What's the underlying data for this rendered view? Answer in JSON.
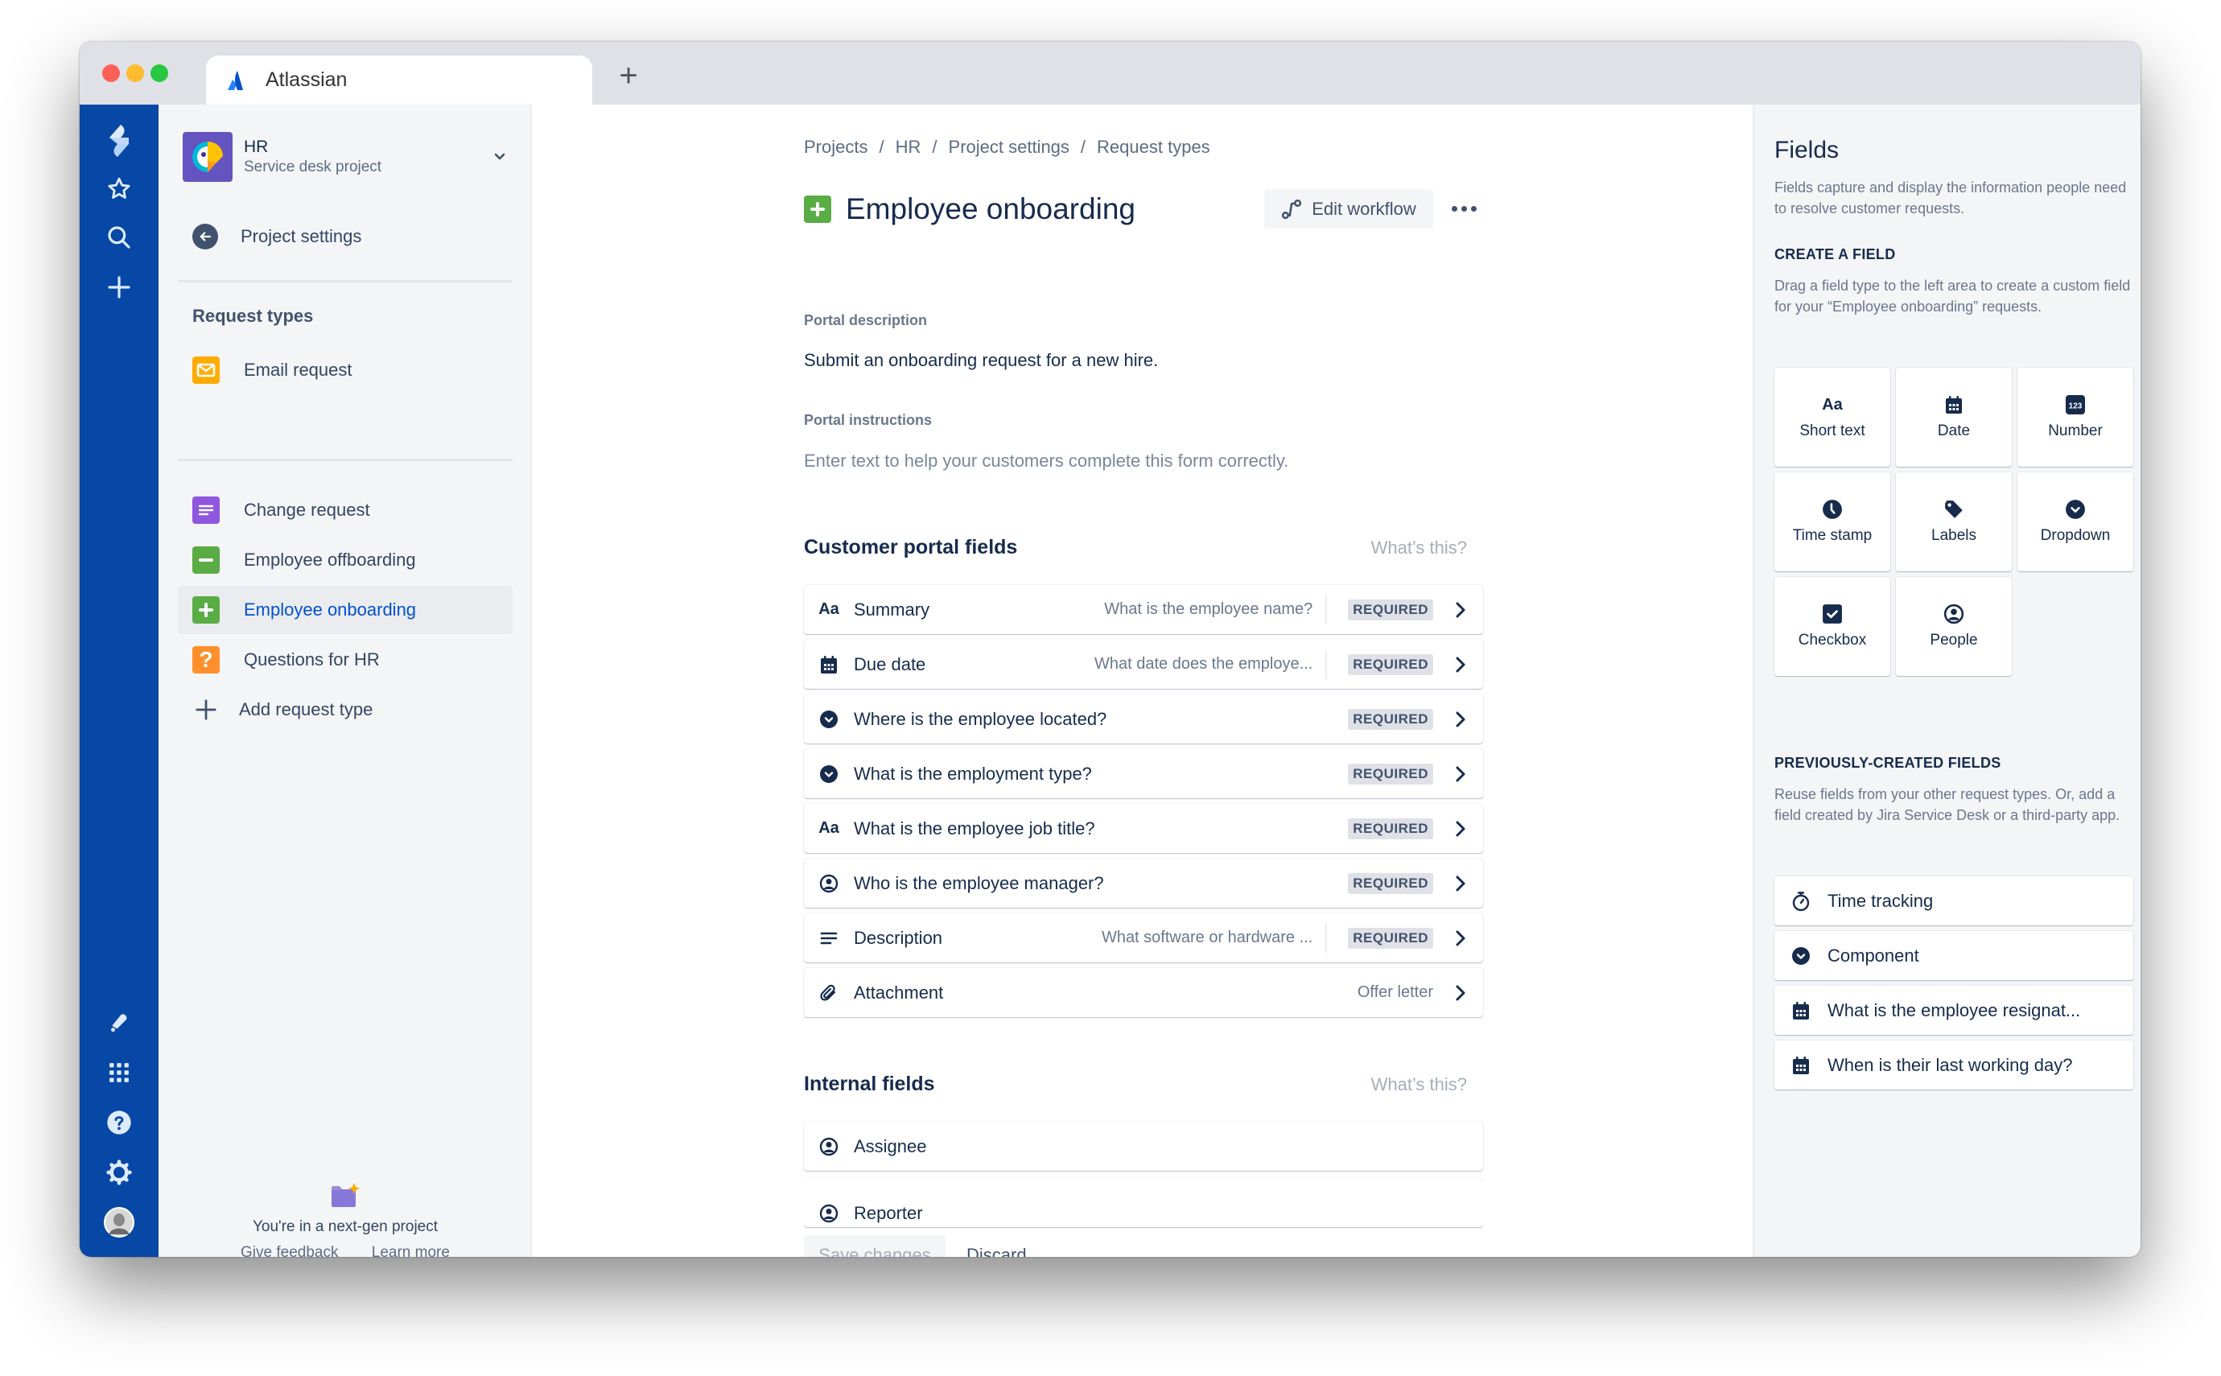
{
  "browser": {
    "tab_title": "Atlassian",
    "new_tab_label": "+"
  },
  "global_nav": {
    "items": [
      {
        "name": "jira-service-desk-logo-icon"
      },
      {
        "name": "star-icon"
      },
      {
        "name": "search-icon"
      },
      {
        "name": "create-icon"
      },
      {
        "name": "notifications-icon"
      },
      {
        "name": "app-switcher-icon"
      },
      {
        "name": "help-icon"
      },
      {
        "name": "settings-icon"
      },
      {
        "name": "user-avatar"
      }
    ]
  },
  "project": {
    "name": "HR",
    "type": "Service desk project",
    "back_label": "Project settings"
  },
  "sidebar": {
    "section_title": "Request types",
    "pinned": [
      {
        "label": "Email request",
        "color": "#ffab00",
        "icon": "envelope-icon"
      }
    ],
    "items": [
      {
        "label": "Change request",
        "color": "#8f56df",
        "icon": "lines-icon",
        "active": false
      },
      {
        "label": "Employee offboarding",
        "color": "#5aac44",
        "icon": "minus-icon",
        "active": false
      },
      {
        "label": "Employee onboarding",
        "color": "#5aac44",
        "icon": "plus-icon",
        "active": true
      },
      {
        "label": "Questions for HR",
        "color": "#ff8f2c",
        "icon": "question-icon",
        "active": false
      }
    ],
    "add_label": "Add request type",
    "next_gen": {
      "text": "You're in a next-gen project",
      "feedback_label": "Give feedback",
      "learn_label": "Learn more"
    }
  },
  "main": {
    "breadcrumb": [
      "Projects",
      "HR",
      "Project settings",
      "Request types"
    ],
    "title": "Employee onboarding",
    "edit_workflow_label": "Edit workflow",
    "portal_description_label": "Portal description",
    "portal_description": "Submit an onboarding request for a new hire.",
    "portal_instructions_label": "Portal instructions",
    "portal_instructions_placeholder": "Enter text to help your customers complete this form correctly.",
    "customer_fields_title": "Customer portal fields",
    "whats_this": "What’s this?",
    "customer_fields": [
      {
        "icon": "short-text-icon",
        "label": "Summary",
        "hint": "What is the employee name?",
        "badge": "REQUIRED"
      },
      {
        "icon": "calendar-icon",
        "label": "Due date",
        "hint": "What date does the employe...",
        "badge": "REQUIRED"
      },
      {
        "icon": "dropdown-icon",
        "label": "Where is the employee located?",
        "hint": "",
        "badge": "REQUIRED"
      },
      {
        "icon": "dropdown-icon",
        "label": "What is the employment type?",
        "hint": "",
        "badge": "REQUIRED"
      },
      {
        "icon": "short-text-icon",
        "label": "What is the employee job title?",
        "hint": "",
        "badge": "REQUIRED"
      },
      {
        "icon": "person-icon",
        "label": "Who is the employee manager?",
        "hint": "",
        "badge": "REQUIRED"
      },
      {
        "icon": "paragraph-icon",
        "label": "Description",
        "hint": "What software or hardware ...",
        "badge": "REQUIRED"
      },
      {
        "icon": "attachment-icon",
        "label": "Attachment",
        "hint": "",
        "badge": "",
        "value": "Offer letter"
      }
    ],
    "internal_fields_title": "Internal fields",
    "internal_fields": [
      {
        "icon": "person-icon",
        "label": "Assignee"
      },
      {
        "icon": "person-icon",
        "label": "Reporter"
      }
    ],
    "save_label": "Save changes",
    "discard_label": "Discard"
  },
  "fields_panel": {
    "title": "Fields",
    "intro": "Fields capture and display the information people need to resolve customer requests.",
    "create_heading": "CREATE A FIELD",
    "create_text": "Drag a field type to the left area to create a custom field for your “Employee onboarding” requests.",
    "field_types": [
      {
        "label": "Short text",
        "icon": "short-text-icon"
      },
      {
        "label": "Date",
        "icon": "calendar-icon"
      },
      {
        "label": "Number",
        "icon": "number-icon"
      },
      {
        "label": "Time stamp",
        "icon": "clock-icon"
      },
      {
        "label": "Labels",
        "icon": "tag-icon"
      },
      {
        "label": "Dropdown",
        "icon": "dropdown-icon"
      },
      {
        "label": "Checkbox",
        "icon": "checkbox-icon"
      },
      {
        "label": "People",
        "icon": "person-icon"
      }
    ],
    "previous_heading": "PREVIOUSLY-CREATED FIELDS",
    "previous_text": "Reuse fields from your other request types. Or, add a field created by Jira Service Desk or a third-party app.",
    "previous_fields": [
      {
        "label": "Time tracking",
        "icon": "stopwatch-icon"
      },
      {
        "label": "Component",
        "icon": "dropdown-icon"
      },
      {
        "label": "What is the employee resignat...",
        "icon": "calendar-icon"
      },
      {
        "label": "When is their last working day?",
        "icon": "calendar-icon"
      }
    ]
  },
  "colors": {
    "nav_blue": "#0747a6",
    "link_blue": "#0052cc",
    "text_dark": "#172b4d"
  }
}
